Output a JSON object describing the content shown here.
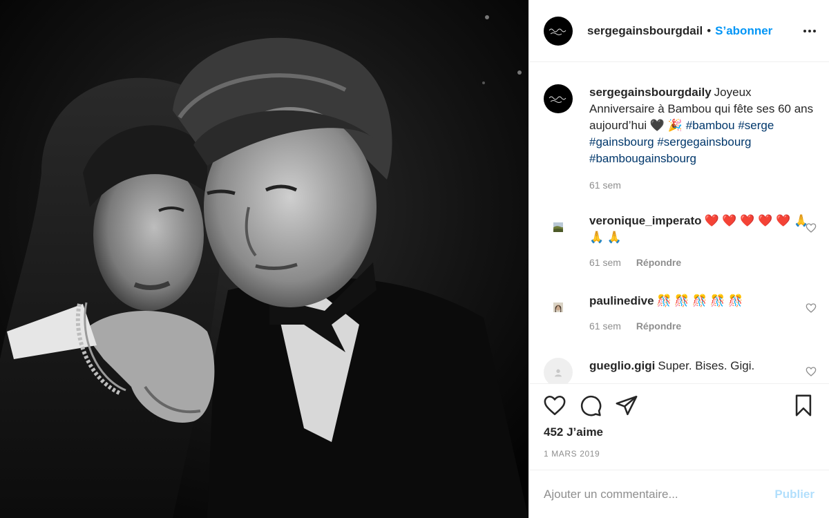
{
  "post": {
    "photo_alt": "photo",
    "author": "sergegainsbourgdail",
    "separator": "•",
    "follow_label": "S’abonner",
    "more_icon": "more-horizontal-icon"
  },
  "caption": {
    "author": "sergegainsbourgdaily",
    "text": "Joyeux Anniversaire à Bambou qui fête ses 60 ans aujourd’hui 🖤 🎉",
    "hashtags": [
      "#bambou",
      "#serge",
      "#gainsbourg",
      "#sergegainsbourg",
      "#bambougainsbourg"
    ],
    "time": "61 sem"
  },
  "comments": [
    {
      "author": "veronique_imperato",
      "text": "❤️ ❤️ ❤️ ❤️ ❤️ 🙏 🙏 🙏",
      "time": "61 sem",
      "reply_label": "Répondre"
    },
    {
      "author": "paulinedive",
      "text": "🎊 🎊 🎊 🎊 🎊",
      "time": "61 sem",
      "reply_label": "Répondre"
    },
    {
      "author": "gueglio.gigi",
      "text": "Super. Bises. Gigi.",
      "time": "",
      "reply_label": ""
    }
  ],
  "actions": {
    "like_icon": "heart-icon",
    "comment_icon": "comment-icon",
    "share_icon": "paper-plane-icon",
    "save_icon": "bookmark-icon"
  },
  "likes_text": "452 J’aime",
  "date_text": "1 MARS 2019",
  "add_comment": {
    "placeholder": "Ajouter un commentaire...",
    "publish_label": "Publier"
  },
  "colors": {
    "accent": "#0095f6",
    "hashtag": "#00376b",
    "muted": "#8e8e8e",
    "publish_disabled": "#b2dffc"
  }
}
